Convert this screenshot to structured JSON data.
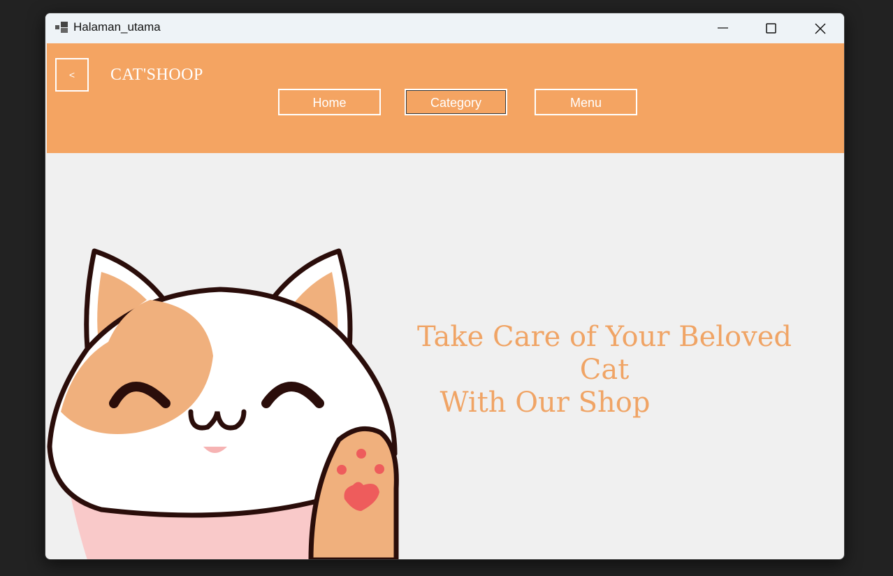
{
  "window": {
    "title": "Halaman_utama",
    "controls": [
      "minimize-icon",
      "maximize-icon",
      "close-icon"
    ]
  },
  "header": {
    "back_label": "<",
    "brand": "CAT'SHOOP",
    "background": "#f4a462",
    "nav": [
      {
        "label": "Home"
      },
      {
        "label": "Category",
        "selected": true
      },
      {
        "label": "Menu"
      }
    ]
  },
  "hero": {
    "tagline_line1": "Take Care of Your Beloved Cat",
    "tagline_line2": "With Our Shop",
    "tagline_color": "#f0a465",
    "image": "waving-cat-illustration"
  }
}
